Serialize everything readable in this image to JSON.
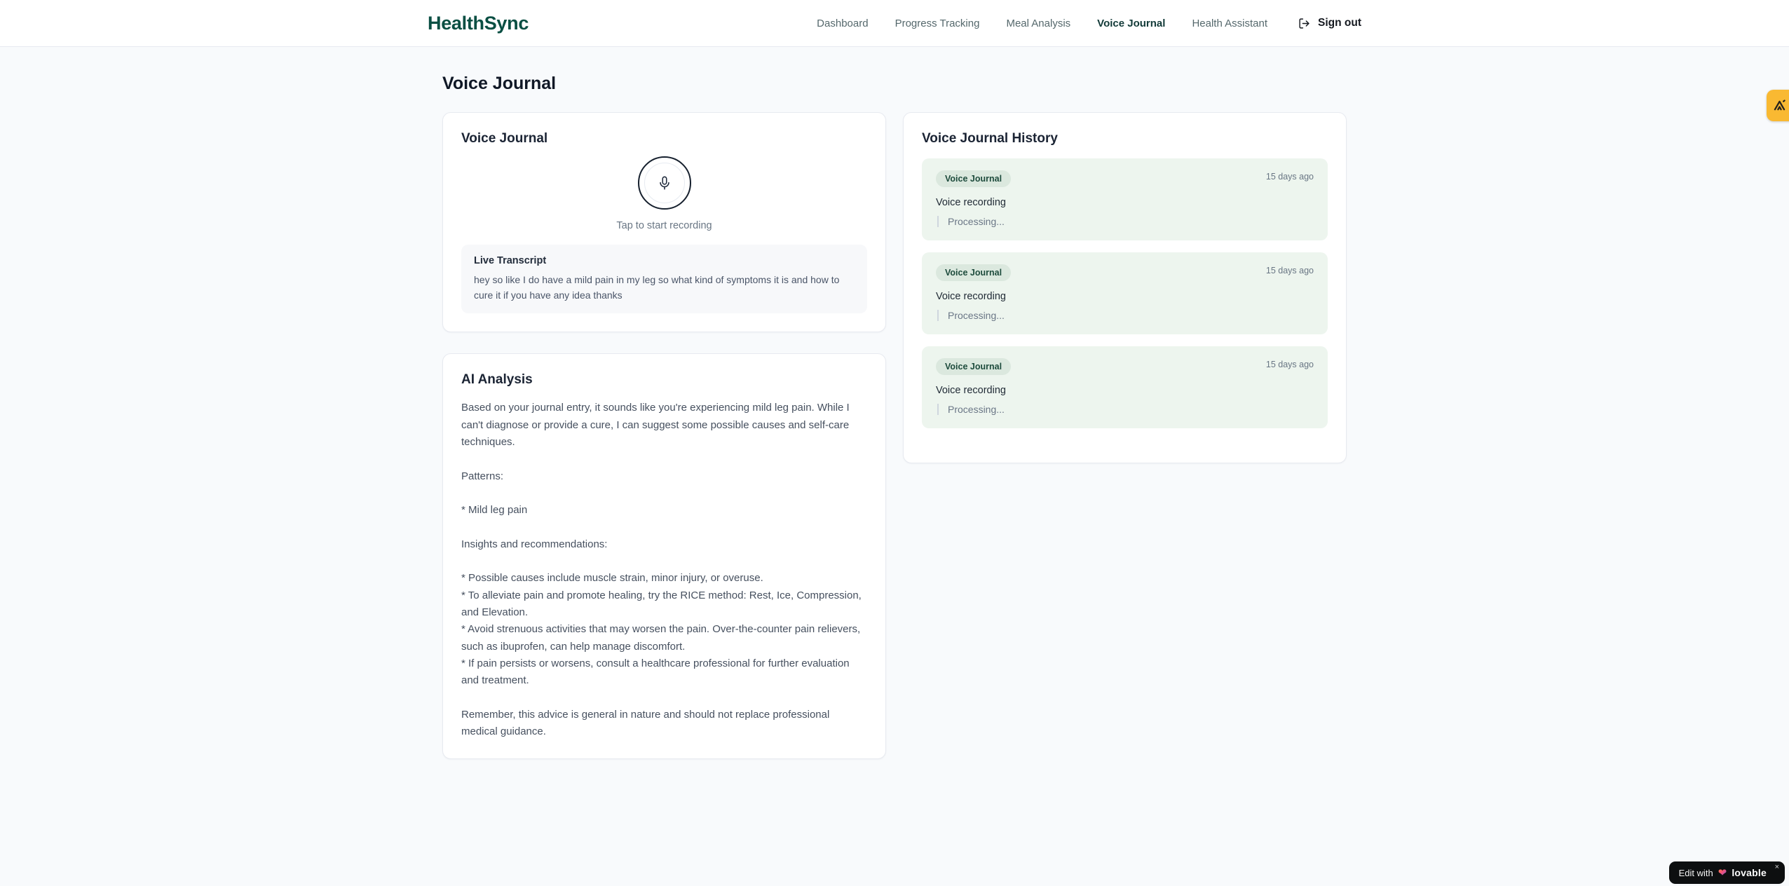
{
  "brand": {
    "name": "HealthSync"
  },
  "nav": {
    "items": [
      {
        "label": "Dashboard",
        "active": false
      },
      {
        "label": "Progress Tracking",
        "active": false
      },
      {
        "label": "Meal Analysis",
        "active": false
      },
      {
        "label": "Voice Journal",
        "active": true
      },
      {
        "label": "Health Assistant",
        "active": false
      }
    ],
    "signout_label": "Sign out"
  },
  "page": {
    "title": "Voice Journal"
  },
  "recorder_card": {
    "title": "Voice Journal",
    "tap_hint": "Tap to start recording",
    "transcript_title": "Live Transcript",
    "transcript_text": "hey so like I do have a mild pain in my leg so what kind of symptoms it is and how to cure it if you have any idea thanks"
  },
  "analysis_card": {
    "title": "AI Analysis",
    "text": "Based on your journal entry, it sounds like you're experiencing mild leg pain. While I can't diagnose or provide a cure, I can suggest some possible causes and self-care techniques.\n\nPatterns:\n\n* Mild leg pain\n\nInsights and recommendations:\n\n* Possible causes include muscle strain, minor injury, or overuse.\n* To alleviate pain and promote healing, try the RICE method: Rest, Ice, Compression, and Elevation.\n* Avoid strenuous activities that may worsen the pain. Over-the-counter pain relievers, such as ibuprofen, can help manage discomfort.\n* If pain persists or worsens, consult a healthcare professional for further evaluation and treatment.\n\nRemember, this advice is general in nature and should not replace professional medical guidance."
  },
  "history_card": {
    "title": "Voice Journal History",
    "entries": [
      {
        "badge": "Voice Journal",
        "time": "15 days ago",
        "label": "Voice recording",
        "status": "Processing..."
      },
      {
        "badge": "Voice Journal",
        "time": "15 days ago",
        "label": "Voice recording",
        "status": "Processing..."
      },
      {
        "badge": "Voice Journal",
        "time": "15 days ago",
        "label": "Voice recording",
        "status": "Processing..."
      }
    ]
  },
  "edit_pill": {
    "prefix": "Edit with",
    "brand": "lovable",
    "close": "×"
  },
  "colors": {
    "brand_green": "#0a4f43",
    "nav_link": "#55686c",
    "nav_active": "#123a38",
    "entry_bg": "#edf5ee",
    "badge_bg": "#dbe8de",
    "badge_text": "#1d4b3c",
    "amber": "#f9b932",
    "pill_bg": "#0d0f10",
    "page_bg": "#f8fafc"
  }
}
